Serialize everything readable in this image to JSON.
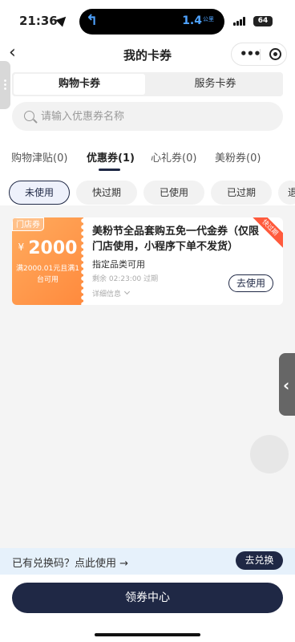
{
  "status_bar": {
    "time": "21:36",
    "island_distance": "1.4",
    "island_unit": "公里",
    "battery": "64"
  },
  "nav": {
    "title": "我的卡券"
  },
  "segments": [
    "购物卡券",
    "服务卡券"
  ],
  "search": {
    "placeholder": "请输入优惠券名称"
  },
  "category_tabs": [
    "购物津贴(0)",
    "优惠券(1)",
    "心礼券(0)",
    "美粉券(0)"
  ],
  "active_category": "优惠券(1)",
  "filter_chips": [
    "未使用",
    "快过期",
    "已使用",
    "已过期",
    "退"
  ],
  "active_chip": "未使用",
  "coupon": {
    "store_tag": "门店券",
    "currency": "¥",
    "amount": "2000",
    "condition": "满2000.01元且满1台可用",
    "title": "美粉节全品套购五免一代金券（仅限门店使用，小程序下单不发货）",
    "scope": "指定品类可用",
    "expire": "剩余 02:23:00 过期",
    "detail": "详细信息",
    "use_button": "去使用",
    "ribbon": "快过期"
  },
  "redeem_bar": {
    "text": "已有兑换码？点此使用 →",
    "button": "去兑换"
  },
  "bottom_button": "领券中心",
  "colors": {
    "primary": "#1f2845",
    "coupon_orange": "#ff8a3d",
    "redeem_bg": "#e6f1fb"
  }
}
